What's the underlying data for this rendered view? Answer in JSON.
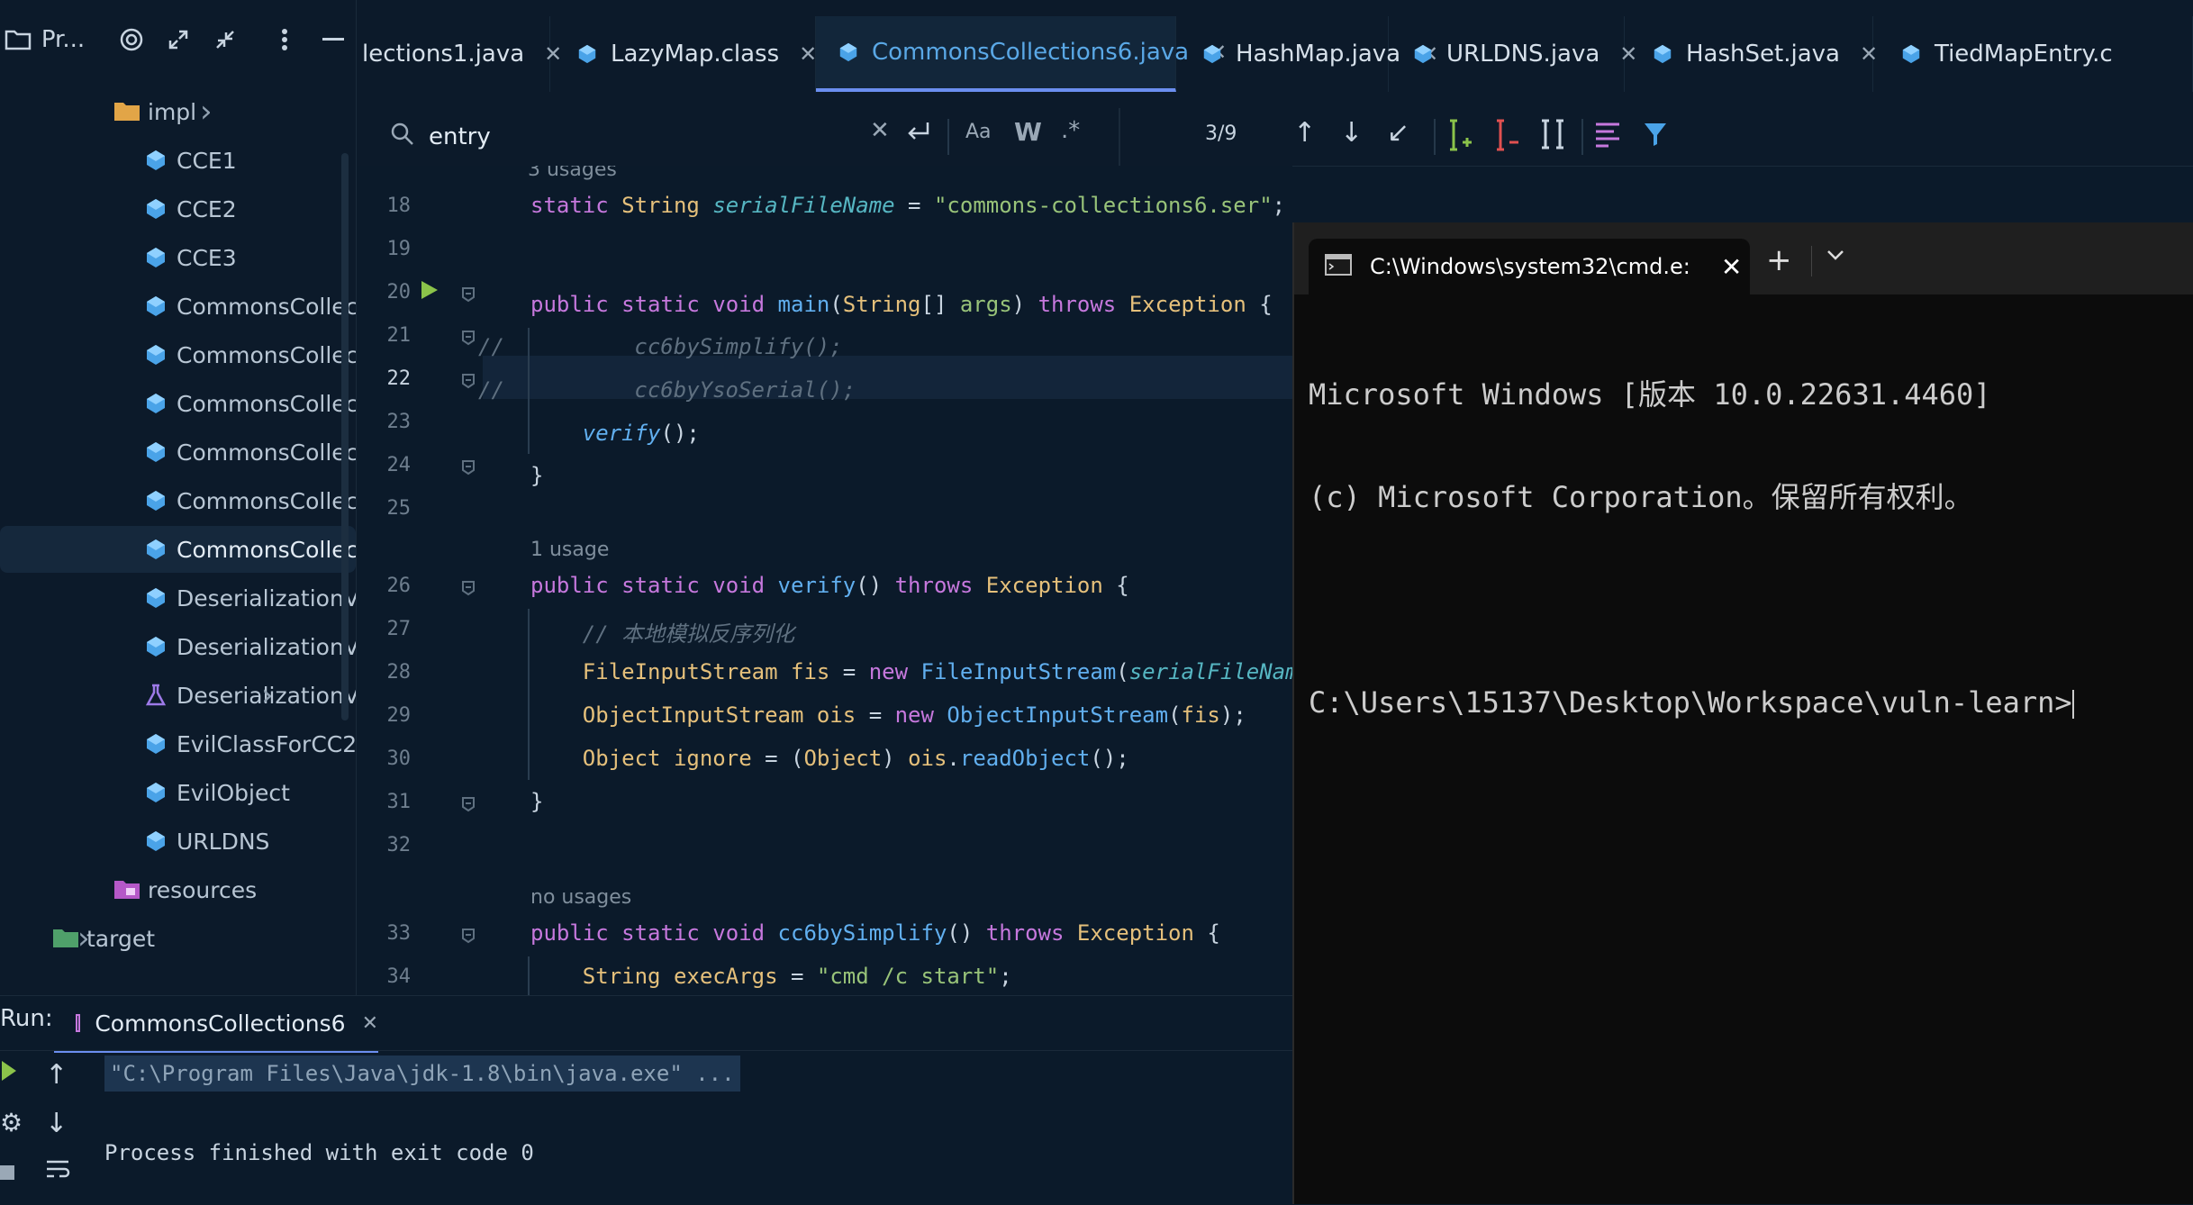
{
  "project": {
    "header_label": "Pr...",
    "items": [
      {
        "label": "impl",
        "kind": "folder",
        "indent": 2,
        "collapsed": true
      },
      {
        "label": "CCE1",
        "kind": "class",
        "indent": 3
      },
      {
        "label": "CCE2",
        "kind": "class",
        "indent": 3
      },
      {
        "label": "CCE3",
        "kind": "class",
        "indent": 3
      },
      {
        "label": "CommonsCollect",
        "kind": "class",
        "indent": 3
      },
      {
        "label": "CommonsCollect",
        "kind": "class",
        "indent": 3
      },
      {
        "label": "CommonsCollect",
        "kind": "class",
        "indent": 3
      },
      {
        "label": "CommonsCollect",
        "kind": "class",
        "indent": 3
      },
      {
        "label": "CommonsCollect",
        "kind": "class",
        "indent": 3
      },
      {
        "label": "CommonsCollect",
        "kind": "class",
        "indent": 3,
        "selected": true
      },
      {
        "label": "DeserializationVu",
        "kind": "class",
        "indent": 3
      },
      {
        "label": "DeserializationVu",
        "kind": "class",
        "indent": 3
      },
      {
        "label": "DeserializationVu",
        "kind": "test",
        "indent": 3,
        "collapsed": true
      },
      {
        "label": "EvilClassForCC2",
        "kind": "class",
        "indent": 3
      },
      {
        "label": "EvilObject",
        "kind": "class",
        "indent": 3
      },
      {
        "label": "URLDNS",
        "kind": "class",
        "indent": 3
      },
      {
        "label": "resources",
        "kind": "resources",
        "indent": 2
      },
      {
        "label": "target",
        "kind": "folder-target",
        "indent": 1,
        "collapsed": true
      }
    ]
  },
  "tabs": [
    {
      "label": "lections1.java"
    },
    {
      "label": "LazyMap.class"
    },
    {
      "label": "CommonsCollections6.java",
      "active": true
    },
    {
      "label": "HashMap.java"
    },
    {
      "label": "URLDNS.java"
    },
    {
      "label": "HashSet.java"
    },
    {
      "label": "TiedMapEntry.c"
    }
  ],
  "find": {
    "query": "entry",
    "match_case": "Aa",
    "words": "W",
    "regex": ".*",
    "count": "3/9"
  },
  "editor": {
    "usages_top": "3 usages",
    "usage_1": "1 usage",
    "usage_none": "no usages",
    "line_numbers": [
      "18",
      "19",
      "20",
      "21",
      "22",
      "23",
      "24",
      "25",
      "26",
      "27",
      "28",
      "29",
      "30",
      "31",
      "32",
      "33",
      "34"
    ]
  },
  "cmd": {
    "tab_title": "C:\\Windows\\system32\\cmd.e:",
    "lines": [
      "Microsoft Windows [版本 10.0.22631.4460]",
      "(c) Microsoft Corporation。保留所有权利。",
      "",
      "C:\\Users\\15137\\Desktop\\Workspace\\vuln-learn>"
    ]
  },
  "run": {
    "label": "Run:",
    "config": "CommonsCollections6",
    "command": "\"C:\\Program Files\\Java\\jdk-1.8\\bin\\java.exe\" ...",
    "result": "Process finished with exit code 0"
  },
  "colors": {
    "accent": "#6b8ef0",
    "keyword": "#c678dd",
    "type": "#e5c07b",
    "string": "#98c379",
    "function": "#61afef"
  }
}
